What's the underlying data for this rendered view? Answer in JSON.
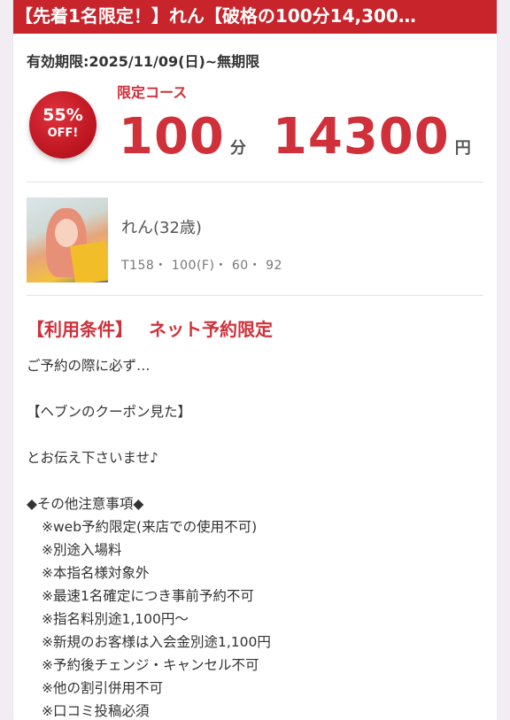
{
  "header": {
    "title": "【先着1名限定！】れん【破格の100分14,300…"
  },
  "coupon": {
    "validity": "有効期限:2025/11/09(日)~無期限",
    "badge": {
      "percent": "55%",
      "label": "OFF!"
    },
    "course_label": "限定コース",
    "duration": "100",
    "duration_unit": "分",
    "price": "14300",
    "price_unit": "円"
  },
  "profile": {
    "name": "れん(32歳)",
    "stats": "T158・ 100(F)・ 60・ 92"
  },
  "terms": {
    "title_left": "【利用条件】",
    "title_right": "ネット予約限定",
    "intro": "ご予約の際に必ず…",
    "keyword": "【ヘブンのクーポン見た】",
    "closing": "とお伝え下さいませ♪",
    "notes_heading": "◆その他注意事項◆",
    "notes": [
      "※web予約限定(来店での使用不可)",
      "※別途入場料",
      "※本指名様対象外",
      "※最速1名確定につき事前予約不可",
      "※指名料別途1,100円〜",
      "※新規のお客様は入会金別途1,100円",
      "※予約後チェンジ・キャンセル不可",
      "※他の割引併用不可",
      "※口コミ投稿必須"
    ]
  },
  "colors": {
    "accent": "#c8242b",
    "price_red": "#d0303a",
    "background": "#f1edf3"
  }
}
